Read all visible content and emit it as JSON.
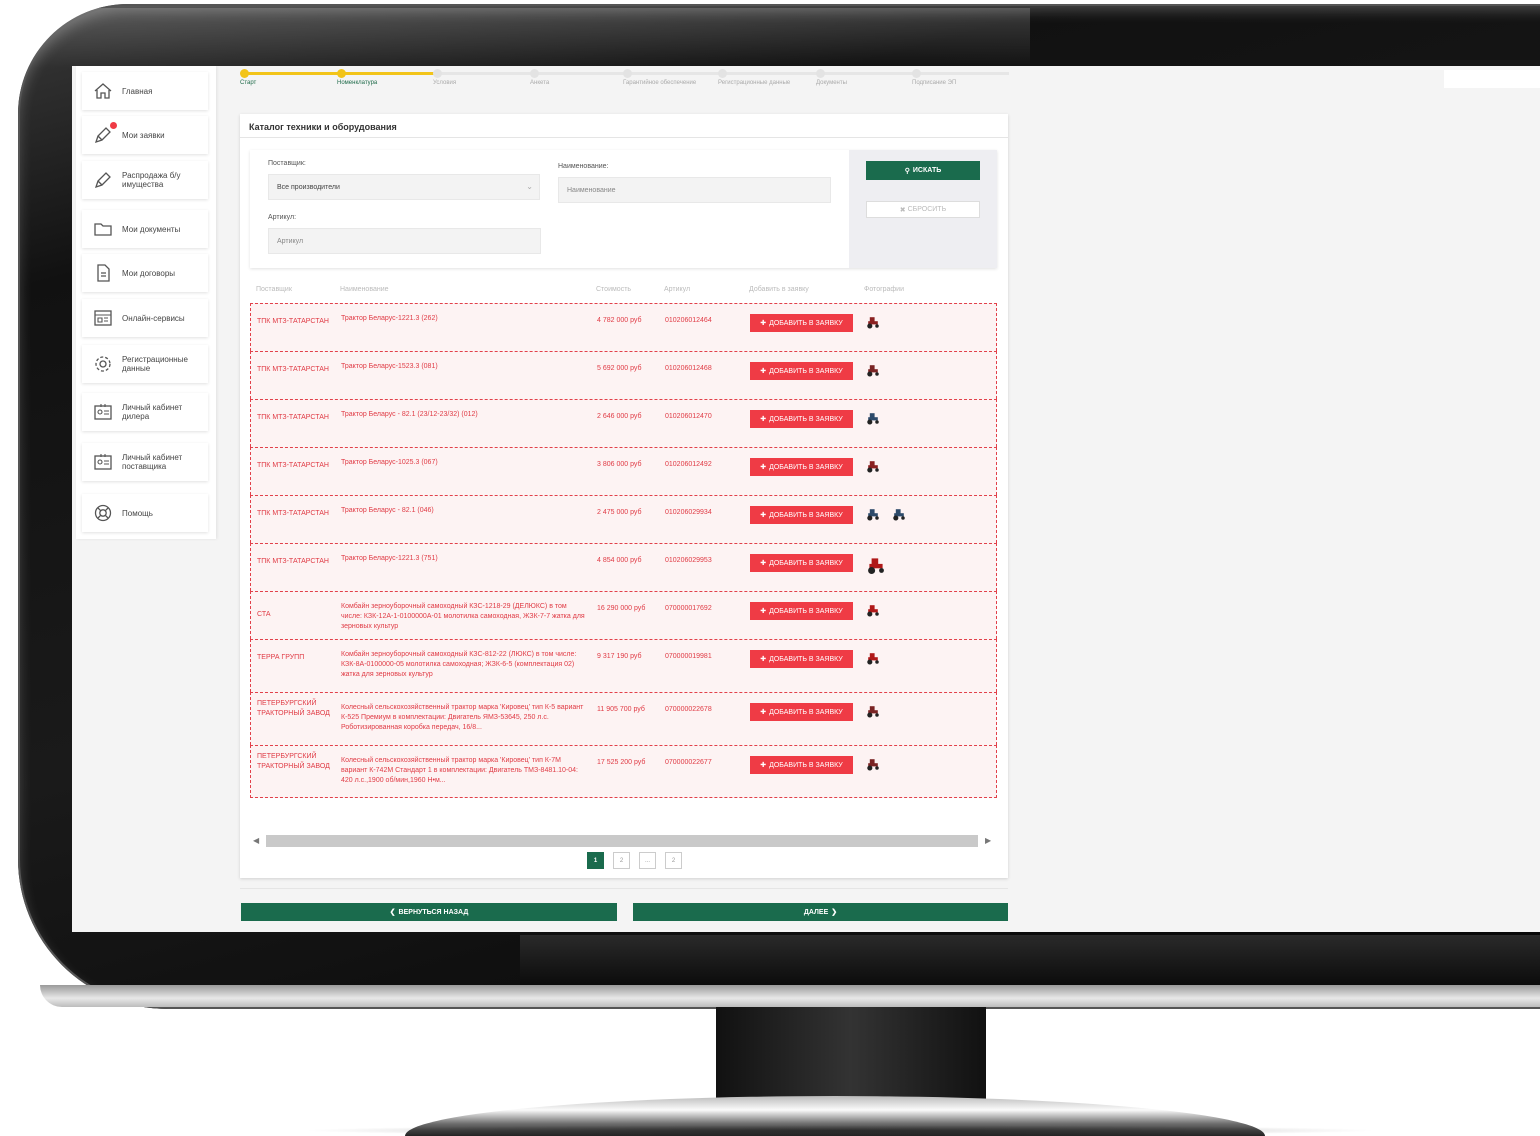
{
  "sidebar": {
    "items": [
      {
        "label": "Главная",
        "icon": "home-icon"
      },
      {
        "label": "Мои заявки",
        "icon": "pen-icon"
      },
      {
        "label": "Распродажа б/у имущества",
        "icon": "pen-icon"
      },
      {
        "label": "Мои документы",
        "icon": "folder-icon"
      },
      {
        "label": "Мои договоры",
        "icon": "document-icon"
      },
      {
        "label": "Онлайн-сервисы",
        "icon": "browser-icon"
      },
      {
        "label": "Регистрационные данные",
        "icon": "gear-icon"
      },
      {
        "label": "Личный кабинет дилера",
        "icon": "id-card-icon"
      },
      {
        "label": "Личный кабинет поставщика",
        "icon": "id-card-icon"
      },
      {
        "label": "Помощь",
        "icon": "lifebuoy-icon"
      }
    ]
  },
  "steps": [
    {
      "label": "Старт",
      "done": true
    },
    {
      "label": "Номенклатура",
      "done": true
    },
    {
      "label": "Условия",
      "done": false
    },
    {
      "label": "Анкета",
      "done": false
    },
    {
      "label": "Гарантийное обеспечение",
      "done": false
    },
    {
      "label": "Регистрационные данные",
      "done": false
    },
    {
      "label": "Документы",
      "done": false
    },
    {
      "label": "Подписание ЭП",
      "done": false
    }
  ],
  "catalog": {
    "title": "Каталог техники и оборудования",
    "filters": {
      "supplier_label": "Поставщик:",
      "supplier_value": "Все производители",
      "name_label": "Наименование:",
      "name_placeholder": "Наименование",
      "article_label": "Артикул:",
      "article_placeholder": "Артикул",
      "search_button": "ИСКАТЬ",
      "reset_button": "СБРОСИТЬ"
    },
    "columns": {
      "supplier": "Поставщик",
      "name": "Наименование",
      "price": "Стоимость",
      "article": "Артикул",
      "add": "Добавить в заявку",
      "photos": "Фотографии"
    },
    "add_button": "ДОБАВИТЬ В ЗАЯВКУ",
    "rows": [
      {
        "supplier": "ТПК МТЗ-ТАТАРСТАН",
        "name": "Трактор Беларус-1221.3 (262)",
        "price": "4 782 000 руб",
        "article": "010206012464",
        "photos": 1,
        "photo_color": "#8a2020"
      },
      {
        "supplier": "ТПК МТЗ-ТАТАРСТАН",
        "name": "Трактор Беларус-1523.3 (081)",
        "price": "5 692 000 руб",
        "article": "010206012468",
        "photos": 1,
        "photo_color": "#7a2424"
      },
      {
        "supplier": "ТПК МТЗ-ТАТАРСТАН",
        "name": "Трактор Беларус - 82.1 (23/12-23/32) (012)",
        "price": "2 646 000 руб",
        "article": "010206012470",
        "photos": 1,
        "photo_color": "#2d4a6a"
      },
      {
        "supplier": "ТПК МТЗ-ТАТАРСТАН",
        "name": "Трактор Беларус-1025.3 (067)",
        "price": "3 806 000 руб",
        "article": "010206012492",
        "photos": 1,
        "photo_color": "#8a2020"
      },
      {
        "supplier": "ТПК МТЗ-ТАТАРСТАН",
        "name": "Трактор Беларус - 82.1 (046)",
        "price": "2 475 000 руб",
        "article": "010206029934",
        "photos": 2,
        "photo_color": "#2d4a6a"
      },
      {
        "supplier": "ТПК МТЗ-ТАТАРСТАН",
        "name": "Трактор Беларус-1221.3 (751)",
        "price": "4 854 000 руб",
        "article": "010206029953",
        "photos": 1,
        "photo_color": "#b01818"
      },
      {
        "supplier": "СТА",
        "name": "Комбайн зерноуборочный самоходный КЗС-1218-29 (ДЕЛЮКС) в том числе: КЗК-12А-1-0100000А-01 молотилка самоходная, ЖЗК-7-7 жатка для зерновых культур",
        "price": "16 290 000 руб",
        "article": "070000017692",
        "photos": 1,
        "photo_color": "#b01818"
      },
      {
        "supplier": "ТЕРРА ГРУПП",
        "name": "Комбайн зерноуборочный самоходный КЗС-812-22 (ЛЮКС) в том числе: КЗК-8А-0100000-05 молотилка самоходная; ЖЗК-6-5 (комплектация 02) жатка для зерновых культур",
        "price": "9 317 190 руб",
        "article": "070000019981",
        "photos": 1,
        "photo_color": "#b01818"
      },
      {
        "supplier": "ПЕТЕРБУРГСКИЙ ТРАКТОРНЫЙ ЗАВОД",
        "name": "Колесный сельскохозяйственный трактор марка 'Кировец' тип К-5 вариант К-525 Премиум в комплектации: Двигатель ЯМЗ-53645, 250 л.с. Роботизированная коробка передач, 16/8...",
        "price": "11 905 700 руб",
        "article": "070000022678",
        "photos": 1,
        "photo_color": "#7a2424"
      },
      {
        "supplier": "ПЕТЕРБУРГСКИЙ ТРАКТОРНЫЙ ЗАВОД",
        "name": "Колесный сельскохозяйственный трактор марка 'Кировец' тип К-7М вариант К-742М Стандарт 1 в комплектации: Двигатель ТМЗ-8481.10-04: 420 л.с.,1900 об/мин,1960 Н•м...",
        "price": "17 525 200 руб",
        "article": "070000022677",
        "photos": 1,
        "photo_color": "#7a2424"
      }
    ],
    "pages": [
      "1",
      "2",
      "...",
      "2"
    ]
  },
  "nav": {
    "back": "ВЕРНУТЬСЯ НАЗАД",
    "next": "ДАЛЕЕ"
  },
  "colors": {
    "brand_green": "#1a6b4d",
    "accent_red": "#ef3b45",
    "progress_yellow": "#f2c419"
  }
}
